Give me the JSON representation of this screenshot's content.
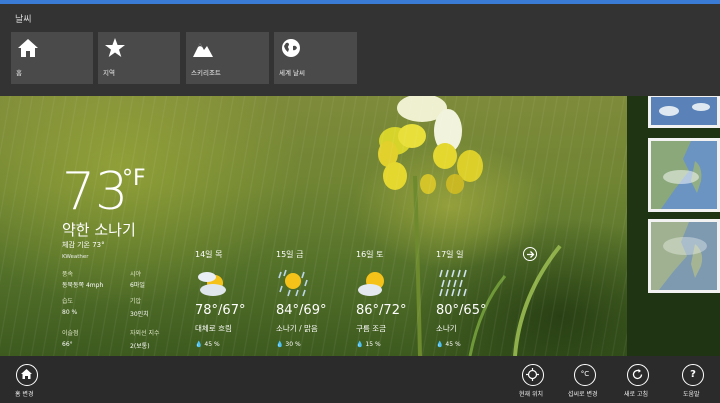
{
  "app": {
    "title": "날씨",
    "accent": "#3a7bd5"
  },
  "nav": {
    "tiles": [
      {
        "label": "홈",
        "icon": "home-icon"
      },
      {
        "label": "지역",
        "icon": "star-icon"
      },
      {
        "label": "스키리조트",
        "icon": "mountain-icon"
      },
      {
        "label": "세계 날씨",
        "icon": "globe-icon"
      }
    ]
  },
  "current": {
    "temp": "73",
    "unit": "°F",
    "condition": "약한 소나기",
    "feels_like": "체감 기온 73°",
    "provider": "KWeather",
    "details": [
      {
        "label": "풍속",
        "value": "동북동쪽 4mph"
      },
      {
        "label": "시야",
        "value": "6마일"
      },
      {
        "label": "습도",
        "value": "80 %"
      },
      {
        "label": "기압",
        "value": "30인치"
      },
      {
        "label": "이슬점",
        "value": "66°"
      },
      {
        "label": "자외선 지수",
        "value": "2(보통)"
      }
    ]
  },
  "forecast": [
    {
      "date": "14일 목",
      "temp": "78°/67°",
      "condition": "대체로 흐림",
      "precip": "45 %",
      "icon": "partly-cloudy-icon"
    },
    {
      "date": "15일 금",
      "temp": "84°/69°",
      "condition": "소나기 / 맑음",
      "precip": "30 %",
      "icon": "sun-shower-icon"
    },
    {
      "date": "16일 토",
      "temp": "86°/72°",
      "condition": "구름 조금",
      "precip": "15 %",
      "icon": "mostly-sunny-icon"
    },
    {
      "date": "17일 일",
      "temp": "80°/65°",
      "condition": "소나기",
      "precip": "45 %",
      "icon": "rain-icon"
    }
  ],
  "appbar": {
    "change_home": "홈 변경",
    "current_location": "현재 위치",
    "change_unit": "섭씨로 변경",
    "refresh": "새로 고침",
    "help": "도움말",
    "unit_glyph": "°C",
    "help_glyph": "?"
  }
}
